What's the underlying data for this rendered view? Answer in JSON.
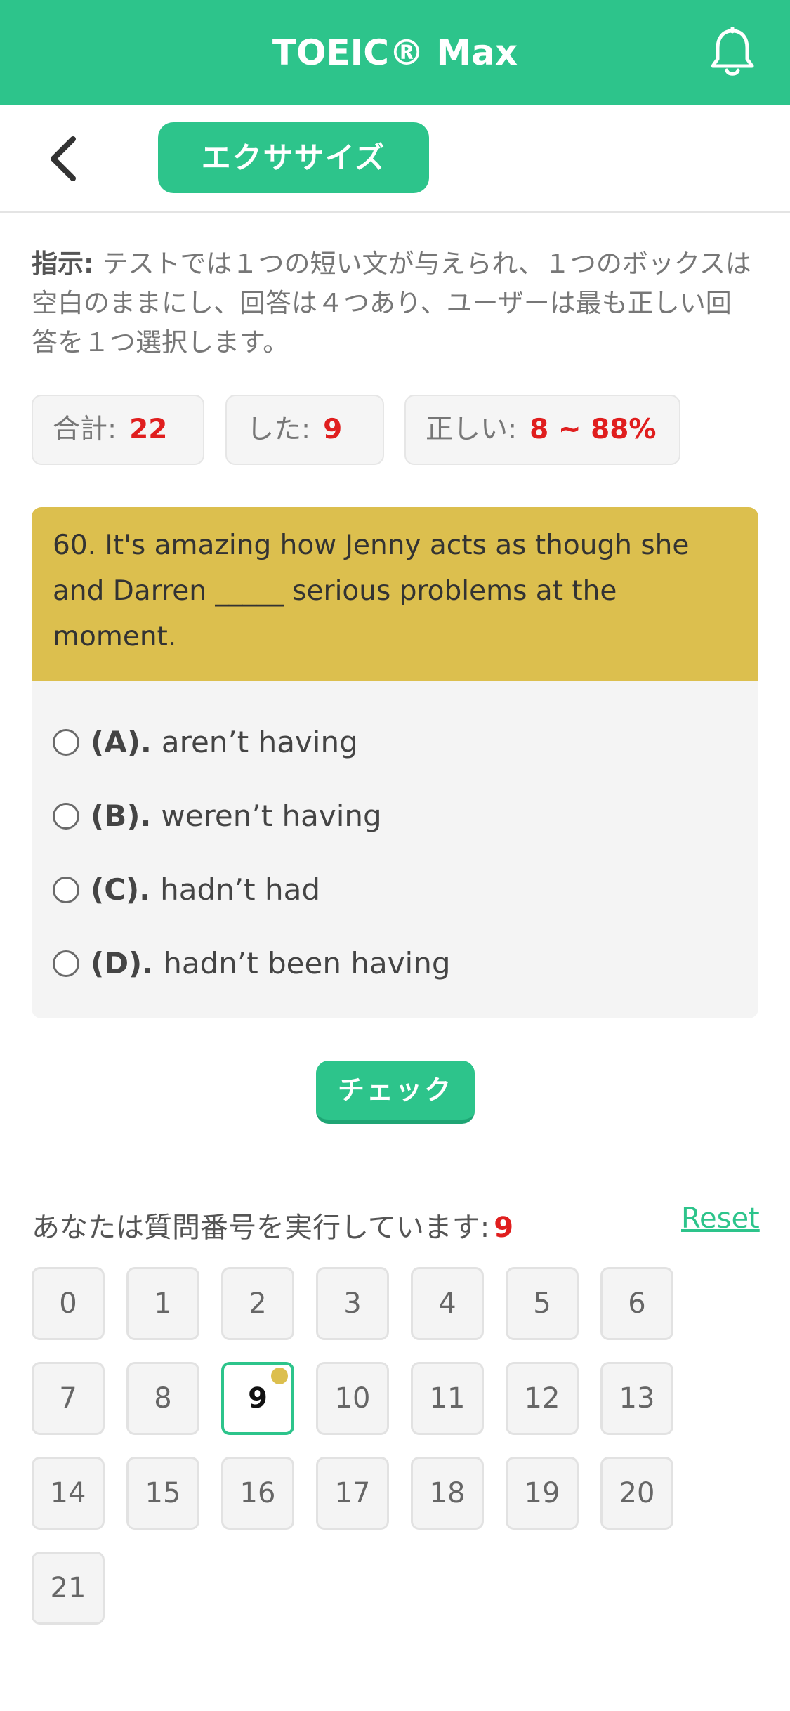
{
  "app": {
    "title": "TOEIC® Max"
  },
  "header": {
    "exercise_label": "エクササイズ"
  },
  "instructions": {
    "label": "指示:",
    "text": " テストでは１つの短い文が与えられ、１つのボックスは空白のままにし、回答は４つあり、ユーザーは最も正しい回答を１つ選択します。"
  },
  "stats": {
    "total_label": "合計:",
    "total_value": "22",
    "done_label": "した:",
    "done_value": "9",
    "correct_label": "正しい:",
    "correct_value": "8 ~ 88%"
  },
  "question": {
    "text": "60. It's amazing how Jenny acts as though she and Darren _____ serious problems at the moment.",
    "options": [
      {
        "key": "(A).",
        "text": "aren’t having"
      },
      {
        "key": "(B).",
        "text": "weren’t having"
      },
      {
        "key": "(C).",
        "text": "hadn’t had"
      },
      {
        "key": "(D).",
        "text": "hadn’t been having"
      }
    ]
  },
  "check_label": "チェック",
  "progress": {
    "label": "あなたは質問番号を実行しています:",
    "current": "9",
    "reset_label": "Reset"
  },
  "grid": {
    "numbers": [
      "0",
      "1",
      "2",
      "3",
      "4",
      "5",
      "6",
      "7",
      "8",
      "9",
      "10",
      "11",
      "12",
      "13",
      "14",
      "15",
      "16",
      "17",
      "18",
      "19",
      "20",
      "21"
    ],
    "active": "9"
  },
  "colors": {
    "primary": "#2dc48b",
    "question_header": "#dcbf4e",
    "highlight_red": "#e01e1e"
  }
}
